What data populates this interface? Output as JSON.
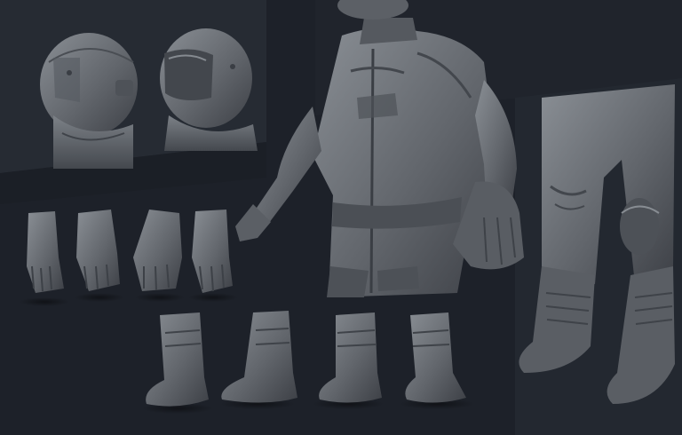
{
  "scene": {
    "background": "#1d2129",
    "panel_color": "#262b33",
    "clay_color": "#6a6e74",
    "clay_dark": "#4f5358",
    "clay_light": "#858a90"
  },
  "groups": [
    {
      "name": "helmet-views",
      "count": 2
    },
    {
      "name": "leather-jacket",
      "count": 1
    },
    {
      "name": "leather-pants",
      "count": 1
    },
    {
      "name": "gloves",
      "count": 4
    },
    {
      "name": "boots",
      "count": 4
    }
  ]
}
